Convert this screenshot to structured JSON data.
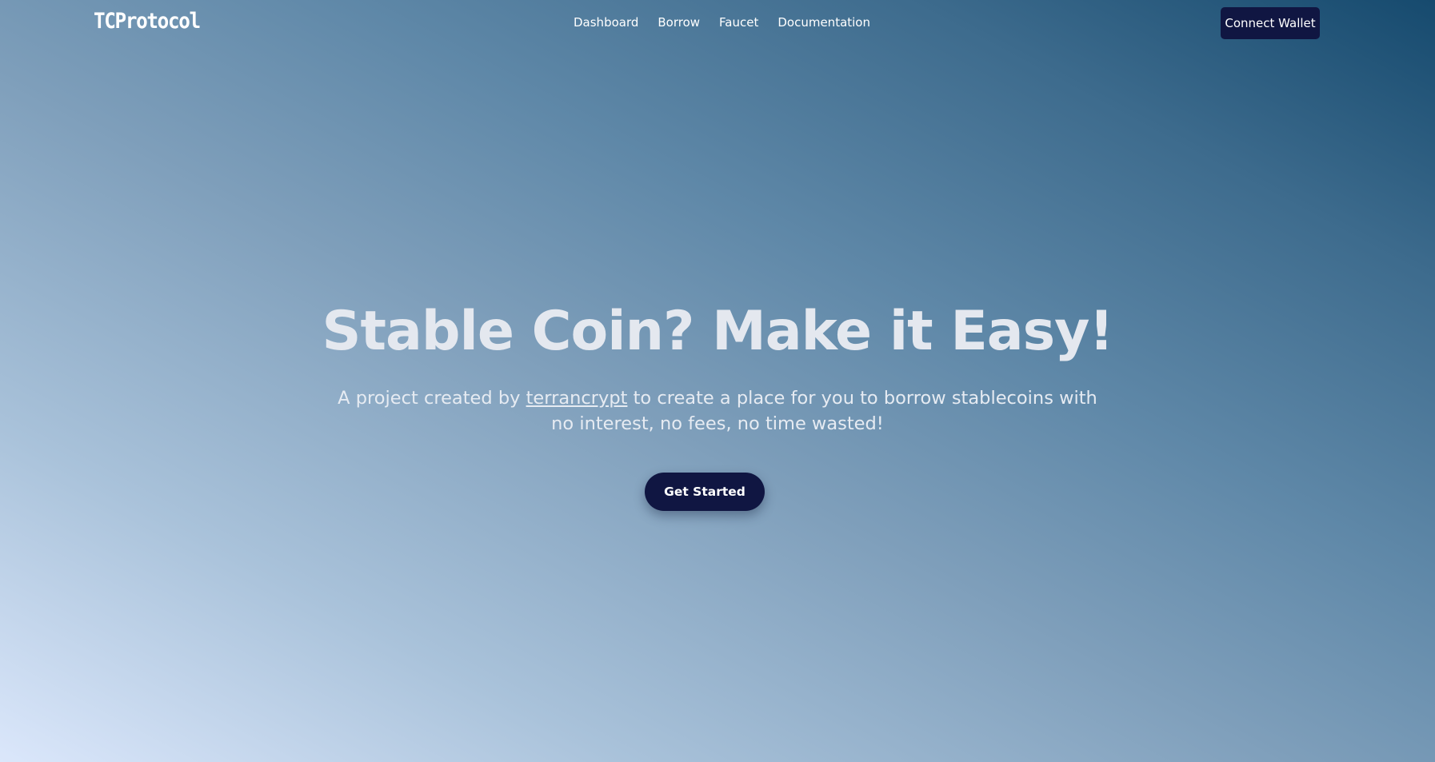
{
  "header": {
    "logo": "TCProtocol",
    "nav": [
      {
        "label": "Dashboard"
      },
      {
        "label": "Borrow"
      },
      {
        "label": "Faucet"
      },
      {
        "label": "Documentation"
      }
    ],
    "connect_label": "Connect Wallet"
  },
  "hero": {
    "title": "Stable Coin? Make it Easy!",
    "subtitle_before": "A project created by ",
    "subtitle_link": "terrancrypt",
    "subtitle_after": " to create a place for you to borrow stablecoins with no interest, no fees, no time wasted!",
    "cta_label": "Get Started"
  },
  "colors": {
    "button_bg": "#101642",
    "gradient_light": "#dbe7fb",
    "gradient_dark": "#164a6e"
  }
}
